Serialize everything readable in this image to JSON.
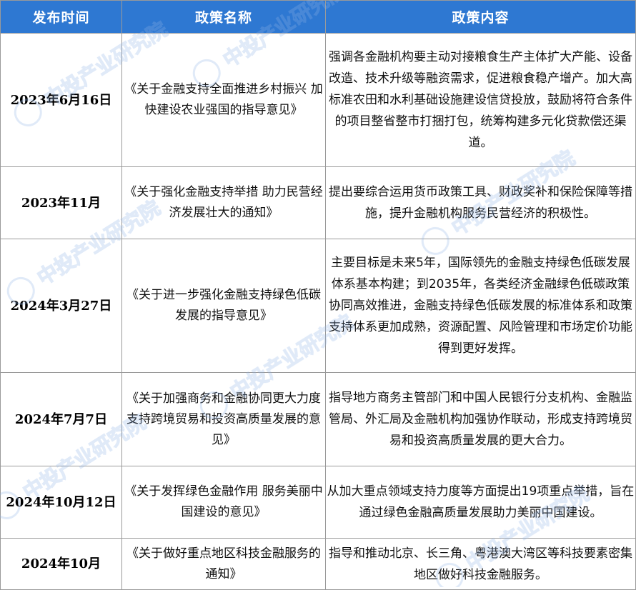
{
  "table": {
    "headers": [
      "发布时间",
      "政策名称",
      "政策内容"
    ],
    "rows": [
      {
        "date": "2023年6月16日",
        "name": "《关于金融支持全面推进乡村振兴 加快建设农业强国的指导意见》",
        "content": "强调各金融机构要主动对接粮食生产主体扩大产能、设备改造、技术升级等融资需求，促进粮食稳产增产。加大高标准农田和水利基础设施建设信贷投放，鼓励将符合条件的项目整省整市打捆打包，统筹构建多元化贷款偿还渠道。"
      },
      {
        "date": "2023年11月",
        "name": "《关于强化金融支持举措 助力民营经济发展壮大的通知》",
        "content": "提出要综合运用货币政策工具、财政奖补和保险保障等措施，提升金融机构服务民营经济的积极性。"
      },
      {
        "date": "2024年3月27日",
        "name": "《关于进一步强化金融支持绿色低碳发展的指导意见》",
        "content": "主要目标是未来5年，国际领先的金融支持绿色低碳发展体系基本构建；到2035年，各类经济金融绿色低碳政策协同高效推进，金融支持绿色低碳发展的标准体系和政策支持体系更加成熟，资源配置、风险管理和市场定价功能得到更好发挥。"
      },
      {
        "date": "2024年7月7日",
        "name": "《关于加强商务和金融协同更大力度支持跨境贸易和投资高质量发展的意见》",
        "content": "指导地方商务主管部门和中国人民银行分支机构、金融监管局、外汇局及金融机构加强协作联动，形成支持跨境贸易和投资高质量发展的更大合力。"
      },
      {
        "date": "2024年10月12日",
        "name": "《关于发挥绿色金融作用 服务美丽中国建设的意见》",
        "content": "从加大重点领域支持力度等方面提出19项重点举措，旨在通过绿色金融高质量发展助力美丽中国建设。"
      },
      {
        "date": "2024年10月",
        "name": "《关于做好重点地区科技金融服务的通知》",
        "content": "指导和推动北京、长三角、粤港澳大湾区等科技要素密集地区做好科技金融服务。"
      }
    ]
  },
  "watermark": {
    "text": "中投产业研究院",
    "color": "#8fb3e6"
  }
}
